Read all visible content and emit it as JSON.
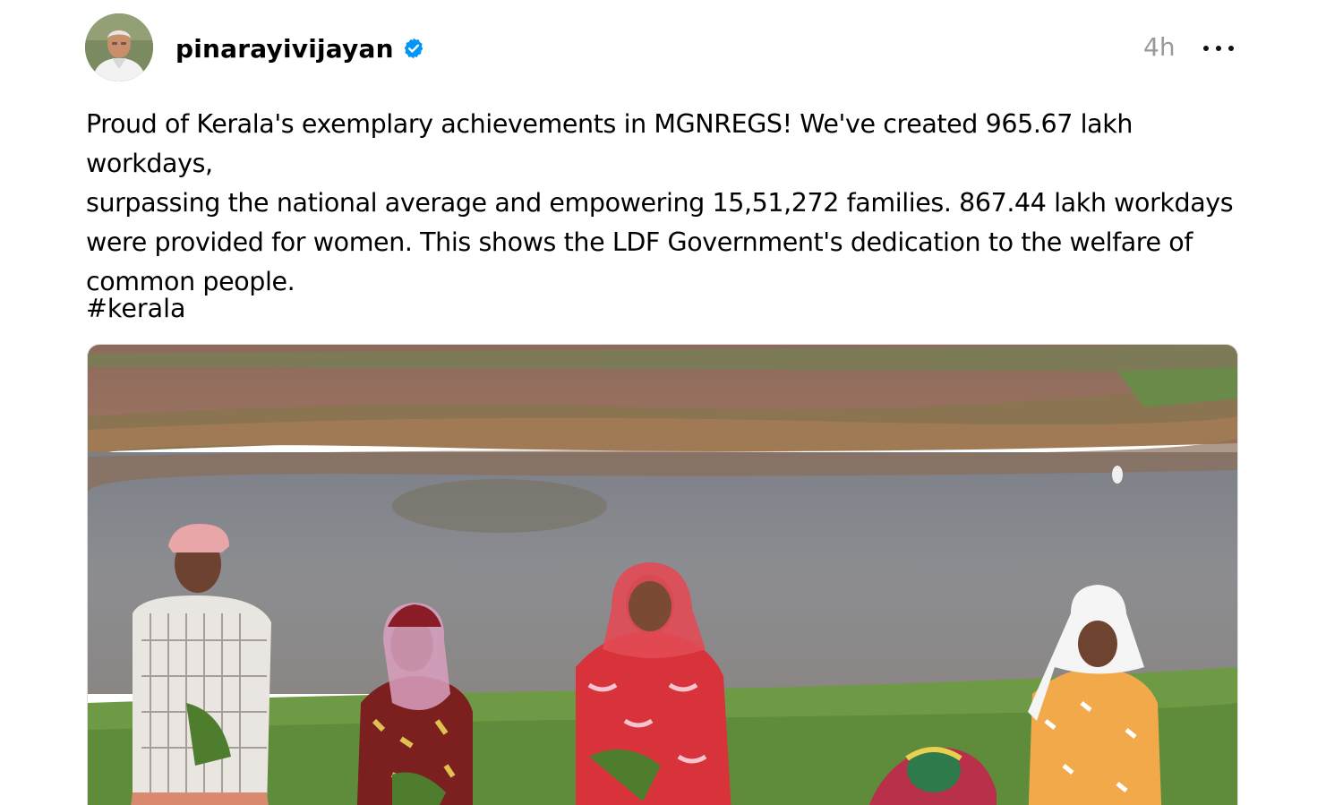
{
  "post": {
    "author": {
      "username": "pinarayivijayan",
      "verified": true,
      "avatar_icon": "profile-photo"
    },
    "timestamp": "4h",
    "more_icon": "more-horizontal-icon",
    "text": "Proud of Kerala's exemplary achievements in MGNREGS! We've created 965.67 lakh workdays,\nsurpassing the national average and empowering 15,51,272 families. 867.44 lakh workdays\nwere provided for women. This shows the LDF Government's dedication to the welfare of\ncommon people.",
    "hashtag": "#kerala",
    "image": {
      "subject": "women-workers-in-paddy-field-photo"
    }
  },
  "colors": {
    "verified_badge": "#0095f6",
    "timestamp": "#999999",
    "text": "#000000"
  }
}
